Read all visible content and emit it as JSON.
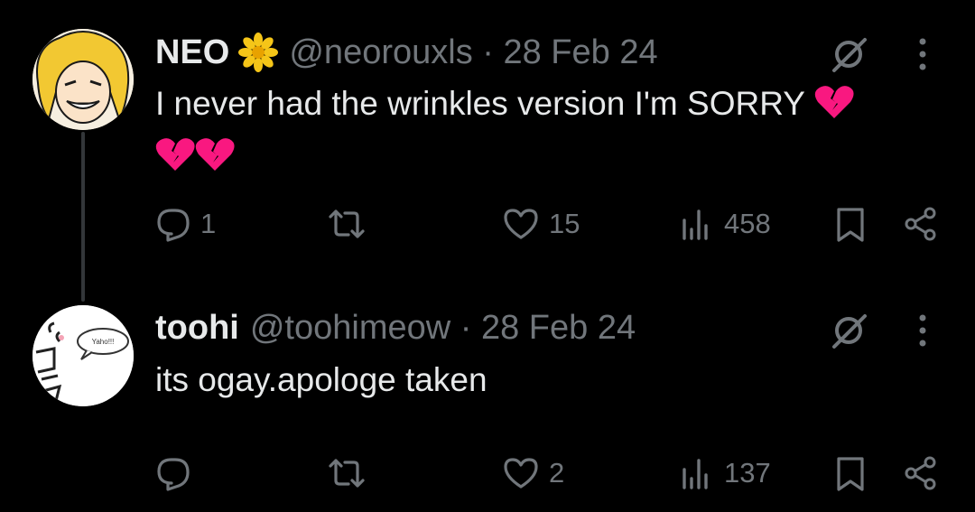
{
  "posts": [
    {
      "name": "NEO",
      "handle_line": "@neorouxls · 28 Feb 24",
      "text": "I never had the wrinkles version I'm SORRY",
      "reply_count": "1",
      "like_count": "15",
      "view_count": "458",
      "emoji": [
        "sunflower",
        "broken-heart",
        "broken-heart",
        "broken-heart"
      ]
    },
    {
      "name": "toohi",
      "handle_line": "@toohimeow · 28 Feb 24",
      "text": "its ogay.apologe taken",
      "reply_count": "",
      "like_count": "2",
      "view_count": "137",
      "avatar_text": "Yaho!!!"
    }
  ],
  "icons": [
    "reply-icon",
    "repost-icon",
    "like-icon",
    "views-icon",
    "bookmark-icon",
    "share-icon",
    "grok-icon",
    "more-icon"
  ],
  "colors": {
    "background": "#000000",
    "text": "#e7e9ea",
    "muted": "#71767b",
    "thread_line": "#333639",
    "heart": "#f91880"
  }
}
